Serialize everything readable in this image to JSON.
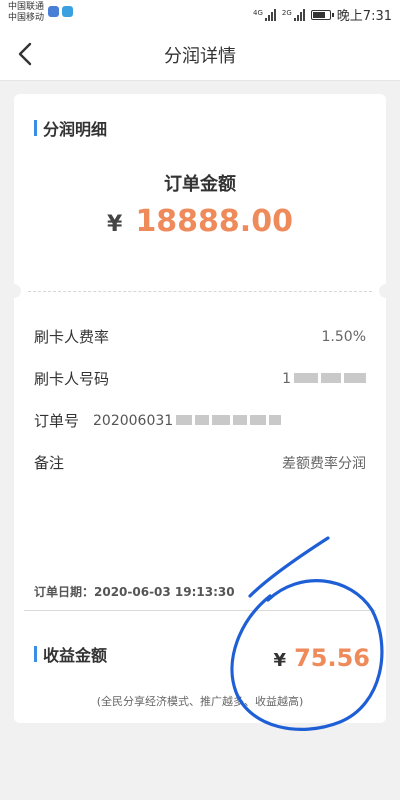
{
  "status_bar": {
    "carrier_1": "中国联通",
    "carrier_2": "中国移动",
    "net_1": "4G",
    "net_2": "2G",
    "time": "晚上7:31"
  },
  "header": {
    "title": "分润详情"
  },
  "detail": {
    "section_title": "分润明细",
    "amount_label": "订单金额",
    "currency": "¥",
    "amount": "18888.00"
  },
  "rows": [
    {
      "label": "刷卡人费率",
      "value": "1.50%"
    },
    {
      "label": "刷卡人号码",
      "value": "1"
    },
    {
      "label": "订单号",
      "value": "202006031"
    },
    {
      "label": "备注",
      "value": "差额费率分润"
    }
  ],
  "order_date": "订单日期：2020-06-03 19:13:30",
  "income": {
    "section_title": "收益金额",
    "currency": "¥",
    "amount": "75.56",
    "note": "(全民分享经济模式、推广越多、收益越高)"
  },
  "colors": {
    "accent_orange": "#ef8b5b",
    "accent_blue_bar": "#3a8ee6",
    "annotation_blue": "#1f5fd6"
  }
}
